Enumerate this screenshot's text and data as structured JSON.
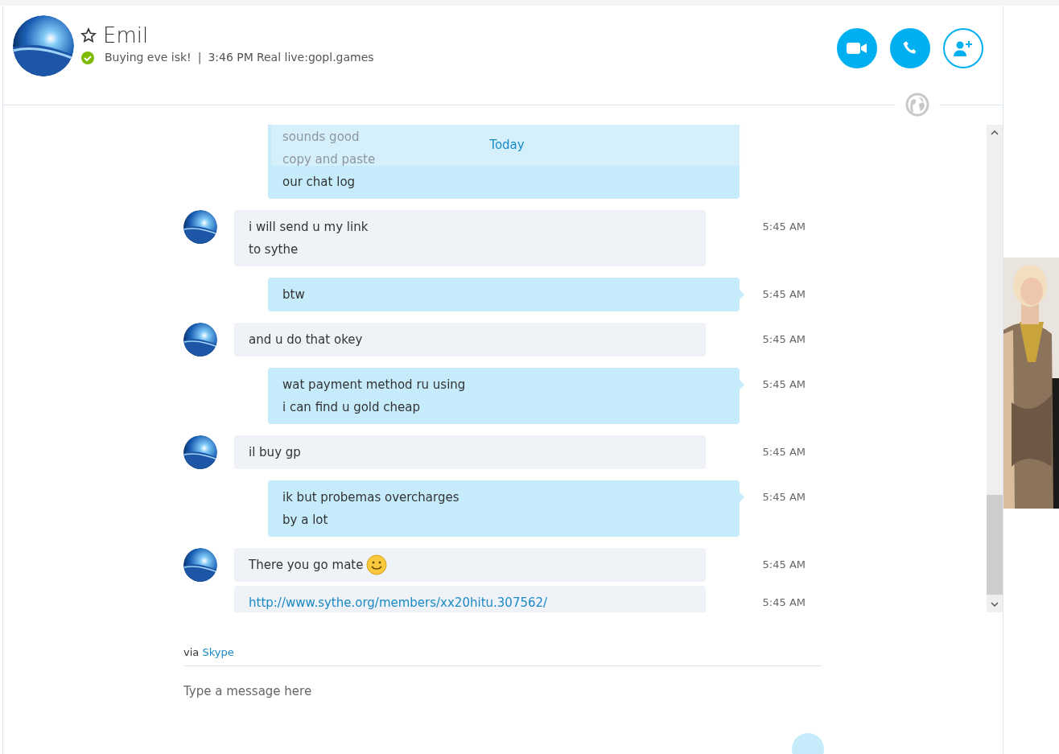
{
  "contact": {
    "name": "Emil",
    "favorite": false,
    "online": true,
    "mood": "Buying eve isk!",
    "separator": "|",
    "local_time": "3:46 PM",
    "account": "Real live:gopl.games"
  },
  "actions": [
    {
      "kind": "video"
    },
    {
      "kind": "call"
    },
    {
      "kind": "add-contact"
    }
  ],
  "date_divider": "Today",
  "messages": [
    {
      "kind": "sent",
      "faded_lines": [
        "sounds good",
        "copy and paste"
      ],
      "lines": [
        "our chat log"
      ]
    },
    {
      "kind": "received",
      "avatar": true,
      "lines": [
        "i will send u my link",
        "to sythe"
      ],
      "time": "5:45 AM"
    },
    {
      "kind": "sent",
      "lines": [
        "btw"
      ],
      "time": "5:45 AM"
    },
    {
      "kind": "received",
      "avatar": true,
      "lines": [
        "and u do that okey"
      ],
      "time": "5:45 AM"
    },
    {
      "kind": "sent",
      "lines": [
        "wat payment method ru using",
        "i can find u gold cheap"
      ],
      "time": "5:45 AM"
    },
    {
      "kind": "received",
      "avatar": true,
      "lines": [
        "il buy gp"
      ],
      "time": "5:45 AM"
    },
    {
      "kind": "sent",
      "lines": [
        "ik but probemas overcharges",
        "by a lot"
      ],
      "time": "5:45 AM"
    },
    {
      "kind": "received",
      "avatar": true,
      "lines": [
        "There you go mate"
      ],
      "emoji": true,
      "time": "5:45 AM"
    },
    {
      "kind": "received",
      "avatar": false,
      "lines": [
        "http://www.sythe.org/members/xx20hitu.307562/"
      ],
      "link": true,
      "time": "5:45 AM"
    }
  ],
  "via": {
    "label": "via",
    "service": "Skype"
  },
  "composer": {
    "placeholder": "Type a message here"
  }
}
